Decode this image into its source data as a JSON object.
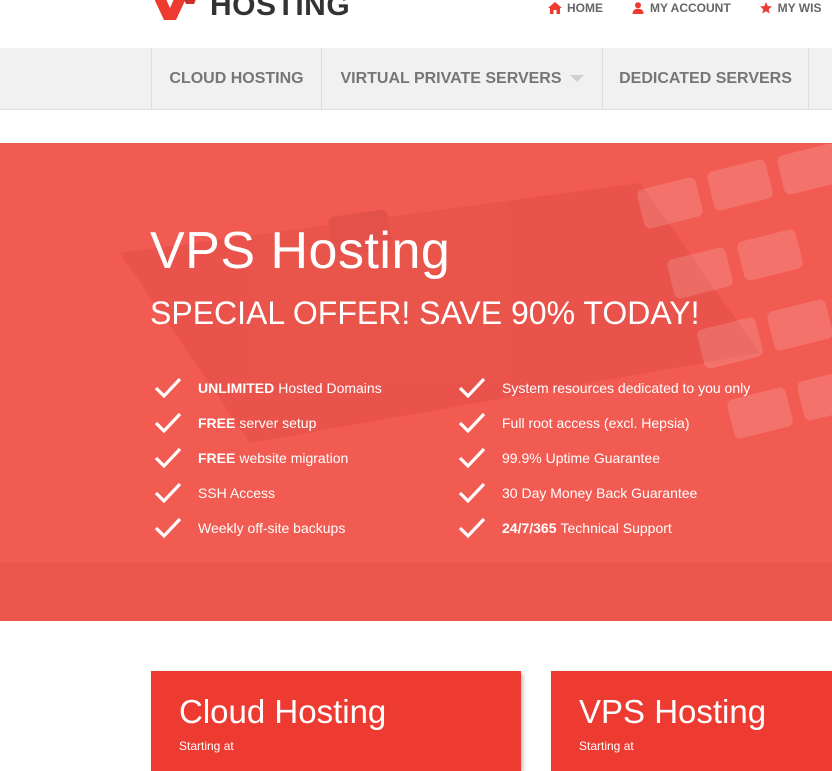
{
  "brand": {
    "name": "HOSTING"
  },
  "toplinks": [
    {
      "label": "HOME",
      "icon": "home-icon"
    },
    {
      "label": "MY ACCOUNT",
      "icon": "user-icon"
    },
    {
      "label": "MY WIS",
      "icon": "star-icon"
    }
  ],
  "nav": [
    {
      "label": "CLOUD HOSTING"
    },
    {
      "label": "VIRTUAL PRIVATE SERVERS",
      "has_dropdown": true
    },
    {
      "label": "DEDICATED SERVERS"
    }
  ],
  "hero": {
    "title": "VPS Hosting",
    "subtitle": "SPECIAL OFFER! SAVE 90% TODAY!",
    "features_left": [
      {
        "bold": "UNLIMITED",
        "text": "Hosted Domains"
      },
      {
        "bold": "FREE",
        "text": "server setup"
      },
      {
        "bold": "FREE",
        "text": "website migration"
      },
      {
        "bold": "",
        "text": "SSH Access"
      },
      {
        "bold": "",
        "text": "Weekly off-site backups"
      }
    ],
    "features_right": [
      {
        "bold": "",
        "text": "System resources dedicated to you only"
      },
      {
        "bold": "",
        "text": "Full root access (excl. Hepsia)"
      },
      {
        "bold": "",
        "text": "99.9% Uptime Guarantee"
      },
      {
        "bold": "",
        "text": "30 Day Money Back Guarantee"
      },
      {
        "bold": "24/7/365",
        "text": "Technical Support"
      }
    ]
  },
  "cards": [
    {
      "title": "Cloud Hosting",
      "subtitle": "Starting at"
    },
    {
      "title": "VPS Hosting",
      "subtitle": "Starting at"
    }
  ],
  "colors": {
    "accent": "#ee3b32",
    "hero_bg": "#f25b52",
    "nav_bg": "#f1f1f1",
    "nav_text": "#767676"
  }
}
